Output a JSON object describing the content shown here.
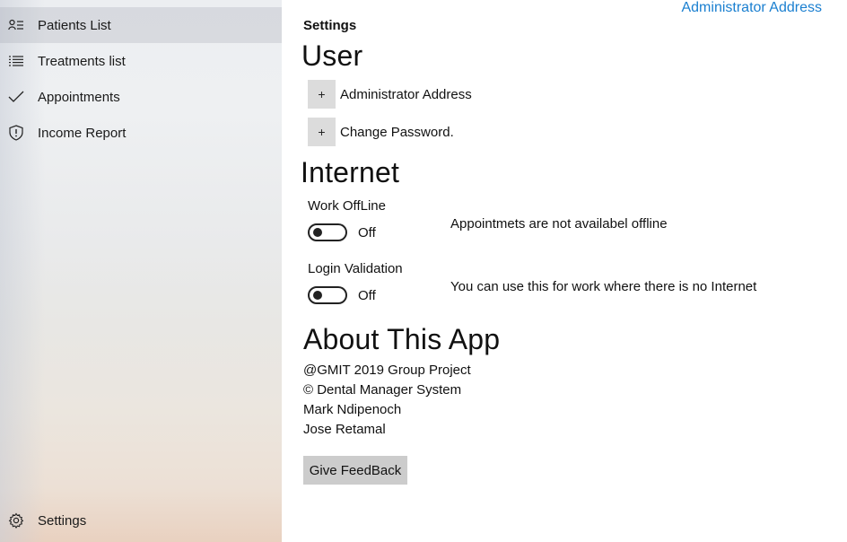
{
  "sidebar": {
    "items": [
      {
        "label": "Patients List",
        "icon": "contact-list-icon"
      },
      {
        "label": "Treatments list",
        "icon": "list-icon"
      },
      {
        "label": "Appointments",
        "icon": "checkmark-icon"
      },
      {
        "label": "Income Report",
        "icon": "shield-icon"
      }
    ],
    "settings": {
      "label": "Settings",
      "icon": "gear-icon"
    }
  },
  "header": {
    "top_link": "Administrator Address",
    "page_title": "Settings"
  },
  "user_section": {
    "heading": "User",
    "expanders": [
      {
        "button": "+",
        "label": "Administrator Address"
      },
      {
        "button": "+",
        "label": "Change Password."
      }
    ]
  },
  "internet_section": {
    "heading": "Internet",
    "toggles": [
      {
        "label": "Work OffLine",
        "state": "Off",
        "note": "Appointmets are not availabel offline"
      },
      {
        "label": "Login Validation",
        "state": "Off",
        "note": "You can use this for work where there is no Internet"
      }
    ]
  },
  "about_section": {
    "heading": "About This App",
    "lines": [
      "@GMIT 2019 Group Project",
      "© Dental Manager System",
      "Mark Ndipenoch",
      "Jose Retamal"
    ],
    "feedback_button": "Give FeedBack"
  },
  "colors": {
    "accent_link": "#1a7fd0",
    "button_gray": "#cccccc",
    "active_nav": "#d3d5d9"
  }
}
